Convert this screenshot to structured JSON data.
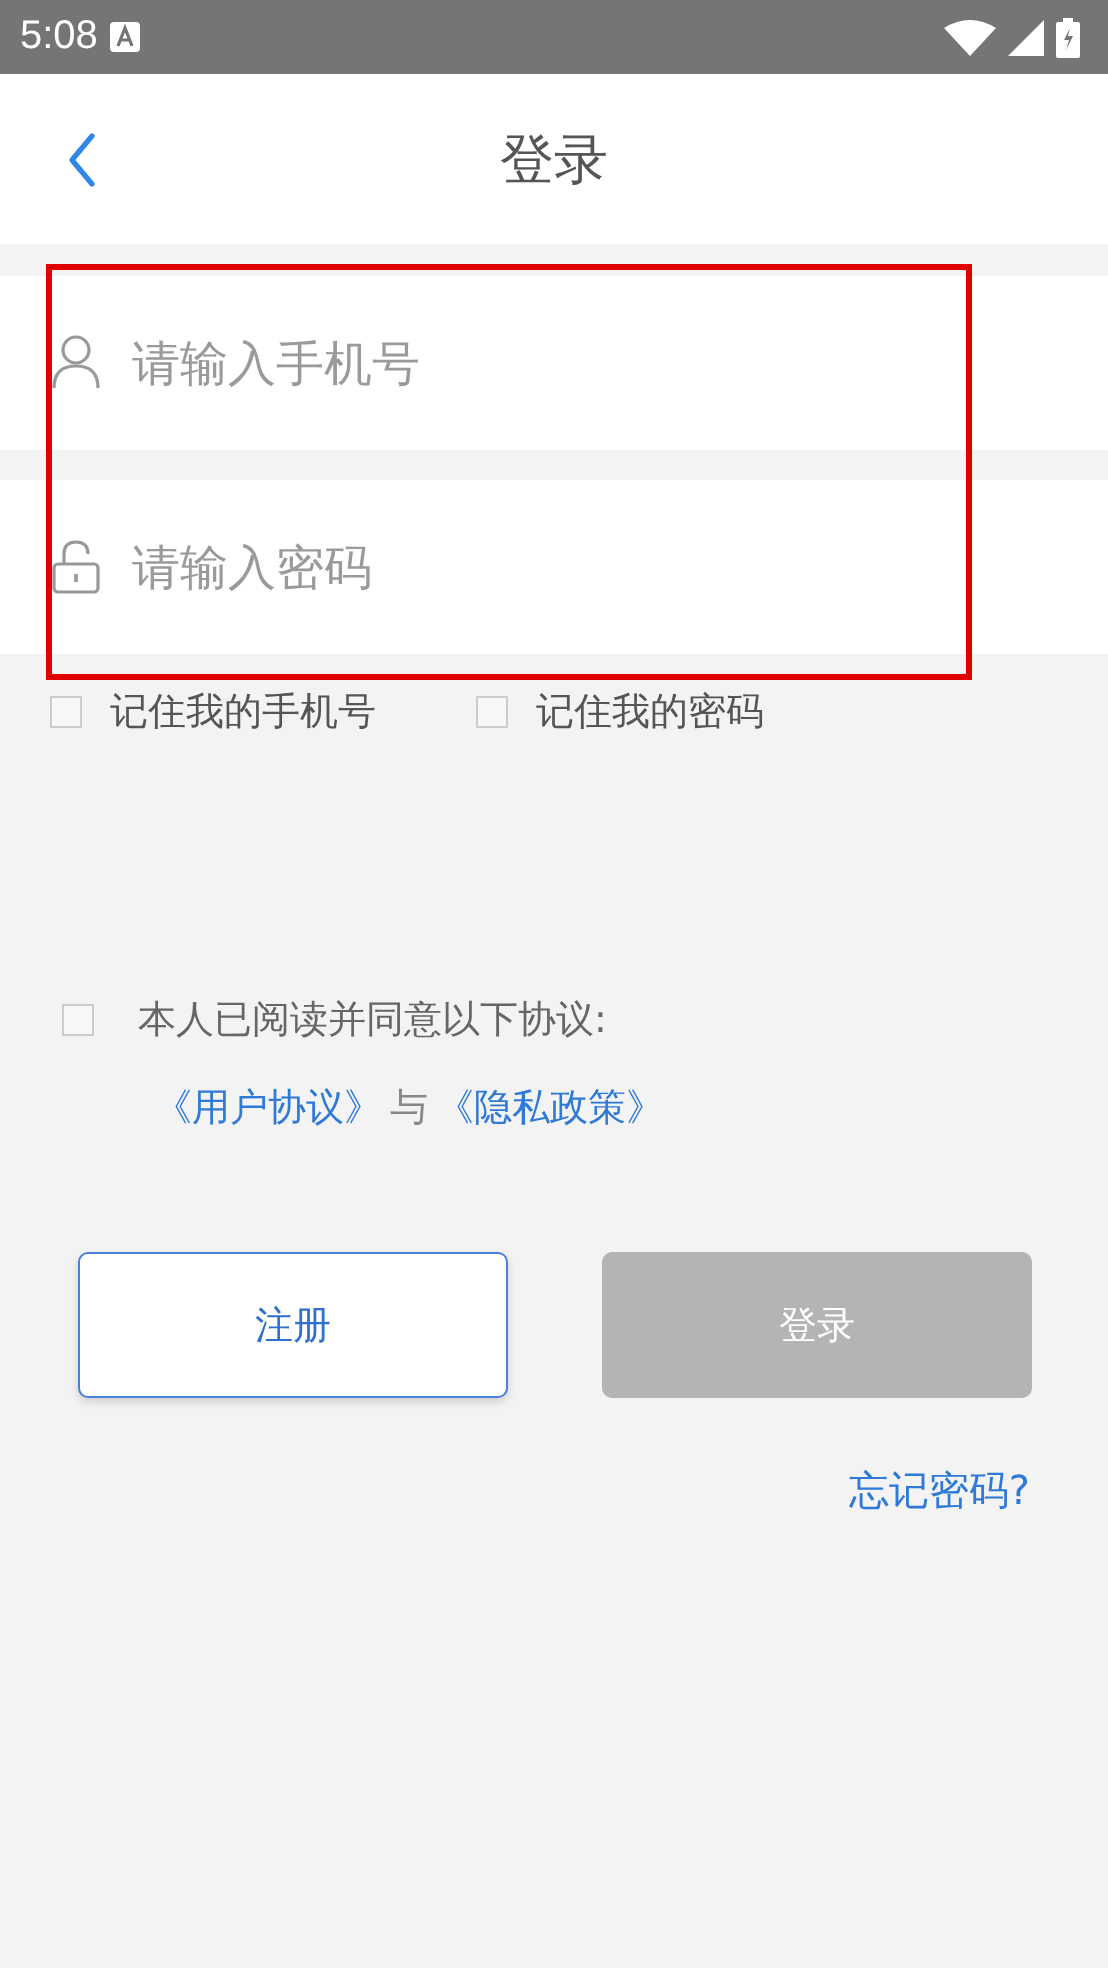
{
  "status_bar": {
    "time": "5:08"
  },
  "header": {
    "title": "登录"
  },
  "form": {
    "highlighted": true,
    "fields": [
      {
        "kind": "phone",
        "placeholder": "请输入手机号"
      },
      {
        "kind": "password",
        "placeholder": "请输入密码"
      }
    ]
  },
  "remember": [
    {
      "label": "记住我的手机号",
      "checked": false
    },
    {
      "label": "记住我的密码",
      "checked": false
    }
  ],
  "agreement": {
    "checked": false,
    "text": "本人已阅读并同意以下协议:",
    "links": [
      {
        "kind": "link",
        "text": "《用户协议》"
      },
      {
        "kind": "plain",
        "text": "与"
      },
      {
        "kind": "link",
        "text": "《隐私政策》"
      }
    ]
  },
  "buttons": [
    {
      "label": "注册",
      "disabled": false
    },
    {
      "label": "登录",
      "disabled": true
    }
  ],
  "forgot": "忘记密码?"
}
